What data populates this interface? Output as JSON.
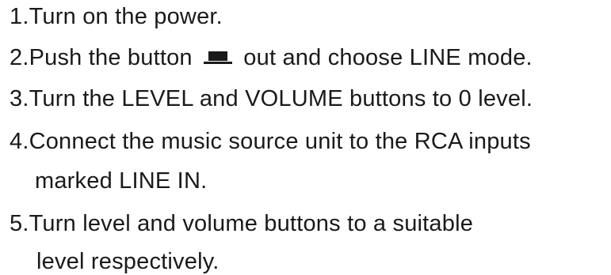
{
  "instructions": {
    "step1": "1.Turn on the power.",
    "step2_before": "2.Push the button",
    "step2_icon": "push-button-icon",
    "step2_after": "out and choose LINE mode.",
    "step3": "3.Turn the LEVEL and VOLUME buttons to 0 level.",
    "step4_line1": "4.Connect the music source unit to the RCA inputs",
    "step4_line2": "marked LINE IN.",
    "step5_line1": "5.Turn level and volume buttons to a suitable",
    "step5_line2": "level respectively."
  }
}
